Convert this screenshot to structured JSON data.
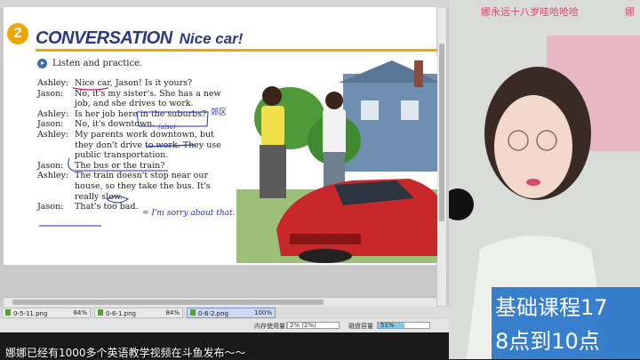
{
  "lesson": {
    "number": "2",
    "title": "CONVERSATION",
    "subtitle": "Nice car!",
    "instruction": "Listen and practice."
  },
  "dialog": [
    {
      "speaker": "Ashley:",
      "text": "Nice car, Jason! Is it yours?"
    },
    {
      "speaker": "Jason:",
      "text": "No, it's my sister's. She has a new"
    },
    {
      "speaker": "",
      "text": "job, and she drives to work."
    },
    {
      "speaker": "Ashley:",
      "text": "Is her job here in the suburbs?"
    },
    {
      "speaker": "Jason:",
      "text": "No, it's downtown."
    },
    {
      "speaker": "Ashley:",
      "text": "My parents work downtown, but"
    },
    {
      "speaker": "",
      "text": "they don't drive to work. They use"
    },
    {
      "speaker": "",
      "text": "public transportation."
    },
    {
      "speaker": "Jason:",
      "text": "The bus or the train?"
    },
    {
      "speaker": "Ashley:",
      "text": "The train doesn't stop near our"
    },
    {
      "speaker": "",
      "text": "house, so they take the bus. It's"
    },
    {
      "speaker": "",
      "text": "really slow."
    },
    {
      "speaker": "Jason:",
      "text": "That's too bad."
    }
  ],
  "annotations": {
    "note_suburbs": "郊区",
    "note_also": "(also)",
    "note_sorry": "= I'm sorry about that."
  },
  "tabs": [
    {
      "name": "0-5-11.png",
      "zoom": "84%"
    },
    {
      "name": "0-6-1.png",
      "zoom": "84%"
    },
    {
      "name": "0-6-2.png",
      "zoom": "100%"
    }
  ],
  "status": {
    "memory_label": "内存使用量",
    "memory_value": "2% (2%)",
    "memory_fill": 0.02,
    "disk_label": "磁盘容量",
    "disk_value": "51%",
    "disk_fill": 0.51
  },
  "caption": "娜娜已经有1000多个英语教学视频在斗鱼发布～～",
  "streamer": {
    "top_text": "娜永远十八岁哇哈哈哈",
    "top_text_right": "娜",
    "promo_line1": "基础课程17",
    "promo_line2": "8点到10点"
  },
  "colors": {
    "accent": "#f0a500",
    "title": "#2b3a7c",
    "ink": "#1c2fc4",
    "promo": "#1e6ec8"
  }
}
